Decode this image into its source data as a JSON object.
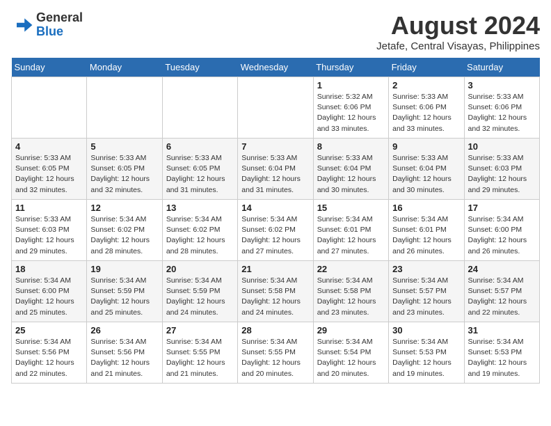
{
  "header": {
    "logo_line1": "General",
    "logo_line2": "Blue",
    "month_year": "August 2024",
    "location": "Jetafe, Central Visayas, Philippines"
  },
  "days_of_week": [
    "Sunday",
    "Monday",
    "Tuesday",
    "Wednesday",
    "Thursday",
    "Friday",
    "Saturday"
  ],
  "weeks": [
    [
      {
        "day": "",
        "info": ""
      },
      {
        "day": "",
        "info": ""
      },
      {
        "day": "",
        "info": ""
      },
      {
        "day": "",
        "info": ""
      },
      {
        "day": "1",
        "info": "Sunrise: 5:32 AM\nSunset: 6:06 PM\nDaylight: 12 hours\nand 33 minutes."
      },
      {
        "day": "2",
        "info": "Sunrise: 5:33 AM\nSunset: 6:06 PM\nDaylight: 12 hours\nand 33 minutes."
      },
      {
        "day": "3",
        "info": "Sunrise: 5:33 AM\nSunset: 6:06 PM\nDaylight: 12 hours\nand 32 minutes."
      }
    ],
    [
      {
        "day": "4",
        "info": "Sunrise: 5:33 AM\nSunset: 6:05 PM\nDaylight: 12 hours\nand 32 minutes."
      },
      {
        "day": "5",
        "info": "Sunrise: 5:33 AM\nSunset: 6:05 PM\nDaylight: 12 hours\nand 32 minutes."
      },
      {
        "day": "6",
        "info": "Sunrise: 5:33 AM\nSunset: 6:05 PM\nDaylight: 12 hours\nand 31 minutes."
      },
      {
        "day": "7",
        "info": "Sunrise: 5:33 AM\nSunset: 6:04 PM\nDaylight: 12 hours\nand 31 minutes."
      },
      {
        "day": "8",
        "info": "Sunrise: 5:33 AM\nSunset: 6:04 PM\nDaylight: 12 hours\nand 30 minutes."
      },
      {
        "day": "9",
        "info": "Sunrise: 5:33 AM\nSunset: 6:04 PM\nDaylight: 12 hours\nand 30 minutes."
      },
      {
        "day": "10",
        "info": "Sunrise: 5:33 AM\nSunset: 6:03 PM\nDaylight: 12 hours\nand 29 minutes."
      }
    ],
    [
      {
        "day": "11",
        "info": "Sunrise: 5:33 AM\nSunset: 6:03 PM\nDaylight: 12 hours\nand 29 minutes."
      },
      {
        "day": "12",
        "info": "Sunrise: 5:34 AM\nSunset: 6:02 PM\nDaylight: 12 hours\nand 28 minutes."
      },
      {
        "day": "13",
        "info": "Sunrise: 5:34 AM\nSunset: 6:02 PM\nDaylight: 12 hours\nand 28 minutes."
      },
      {
        "day": "14",
        "info": "Sunrise: 5:34 AM\nSunset: 6:02 PM\nDaylight: 12 hours\nand 27 minutes."
      },
      {
        "day": "15",
        "info": "Sunrise: 5:34 AM\nSunset: 6:01 PM\nDaylight: 12 hours\nand 27 minutes."
      },
      {
        "day": "16",
        "info": "Sunrise: 5:34 AM\nSunset: 6:01 PM\nDaylight: 12 hours\nand 26 minutes."
      },
      {
        "day": "17",
        "info": "Sunrise: 5:34 AM\nSunset: 6:00 PM\nDaylight: 12 hours\nand 26 minutes."
      }
    ],
    [
      {
        "day": "18",
        "info": "Sunrise: 5:34 AM\nSunset: 6:00 PM\nDaylight: 12 hours\nand 25 minutes."
      },
      {
        "day": "19",
        "info": "Sunrise: 5:34 AM\nSunset: 5:59 PM\nDaylight: 12 hours\nand 25 minutes."
      },
      {
        "day": "20",
        "info": "Sunrise: 5:34 AM\nSunset: 5:59 PM\nDaylight: 12 hours\nand 24 minutes."
      },
      {
        "day": "21",
        "info": "Sunrise: 5:34 AM\nSunset: 5:58 PM\nDaylight: 12 hours\nand 24 minutes."
      },
      {
        "day": "22",
        "info": "Sunrise: 5:34 AM\nSunset: 5:58 PM\nDaylight: 12 hours\nand 23 minutes."
      },
      {
        "day": "23",
        "info": "Sunrise: 5:34 AM\nSunset: 5:57 PM\nDaylight: 12 hours\nand 23 minutes."
      },
      {
        "day": "24",
        "info": "Sunrise: 5:34 AM\nSunset: 5:57 PM\nDaylight: 12 hours\nand 22 minutes."
      }
    ],
    [
      {
        "day": "25",
        "info": "Sunrise: 5:34 AM\nSunset: 5:56 PM\nDaylight: 12 hours\nand 22 minutes."
      },
      {
        "day": "26",
        "info": "Sunrise: 5:34 AM\nSunset: 5:56 PM\nDaylight: 12 hours\nand 21 minutes."
      },
      {
        "day": "27",
        "info": "Sunrise: 5:34 AM\nSunset: 5:55 PM\nDaylight: 12 hours\nand 21 minutes."
      },
      {
        "day": "28",
        "info": "Sunrise: 5:34 AM\nSunset: 5:55 PM\nDaylight: 12 hours\nand 20 minutes."
      },
      {
        "day": "29",
        "info": "Sunrise: 5:34 AM\nSunset: 5:54 PM\nDaylight: 12 hours\nand 20 minutes."
      },
      {
        "day": "30",
        "info": "Sunrise: 5:34 AM\nSunset: 5:53 PM\nDaylight: 12 hours\nand 19 minutes."
      },
      {
        "day": "31",
        "info": "Sunrise: 5:34 AM\nSunset: 5:53 PM\nDaylight: 12 hours\nand 19 minutes."
      }
    ]
  ]
}
